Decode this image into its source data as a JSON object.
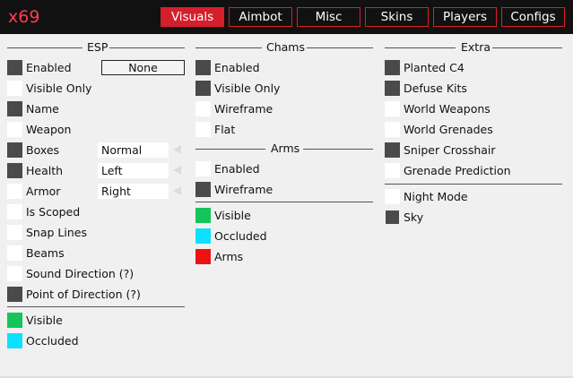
{
  "app": {
    "brand": "x69"
  },
  "tabs": [
    {
      "label": "Visuals",
      "active": true
    },
    {
      "label": "Aimbot"
    },
    {
      "label": "Misc"
    },
    {
      "label": "Skins"
    },
    {
      "label": "Players"
    },
    {
      "label": "Configs"
    }
  ],
  "esp": {
    "title": "ESP",
    "items": [
      {
        "label": "Enabled",
        "checked": true
      },
      {
        "label": "Visible Only",
        "checked": false
      },
      {
        "label": "Name",
        "checked": true
      },
      {
        "label": "Weapon",
        "checked": false
      },
      {
        "label": "Boxes",
        "checked": true
      },
      {
        "label": "Health",
        "checked": true
      },
      {
        "label": "Armor",
        "checked": false
      },
      {
        "label": "Is Scoped",
        "checked": false
      },
      {
        "label": "Snap Lines",
        "checked": false
      },
      {
        "label": "Beams",
        "checked": false
      },
      {
        "label": "Sound Direction (?)",
        "checked": false
      },
      {
        "label": "Point of Direction (?)",
        "checked": true
      }
    ],
    "none_button": "None",
    "boxes_select": "Normal",
    "health_select": "Left",
    "armor_select": "Right",
    "colors": [
      {
        "label": "Visible",
        "color": "#16c45a"
      },
      {
        "label": "Occluded",
        "color": "#0ee0ff"
      }
    ]
  },
  "chams": {
    "title": "Chams",
    "items": [
      {
        "label": "Enabled",
        "checked": true
      },
      {
        "label": "Visible Only",
        "checked": true
      },
      {
        "label": "Wireframe",
        "checked": false
      },
      {
        "label": "Flat",
        "checked": false
      }
    ]
  },
  "arms": {
    "title": "Arms",
    "items": [
      {
        "label": "Enabled",
        "checked": false
      },
      {
        "label": "Wireframe",
        "checked": true
      }
    ],
    "colors": [
      {
        "label": "Visible",
        "color": "#16c45a"
      },
      {
        "label": "Occluded",
        "color": "#0ee0ff"
      },
      {
        "label": "Arms",
        "color": "#ee1111"
      }
    ]
  },
  "extra": {
    "title": "Extra",
    "items": [
      {
        "label": "Planted C4",
        "checked": true
      },
      {
        "label": "Defuse Kits",
        "checked": true
      },
      {
        "label": "World Weapons",
        "checked": false
      },
      {
        "label": "World Grenades",
        "checked": false
      },
      {
        "label": "Sniper Crosshair",
        "checked": true
      },
      {
        "label": "Grenade Prediction",
        "checked": false
      }
    ],
    "items2": [
      {
        "label": "Night Mode",
        "checked": false
      },
      {
        "label": "Sky",
        "checked": true
      }
    ]
  }
}
